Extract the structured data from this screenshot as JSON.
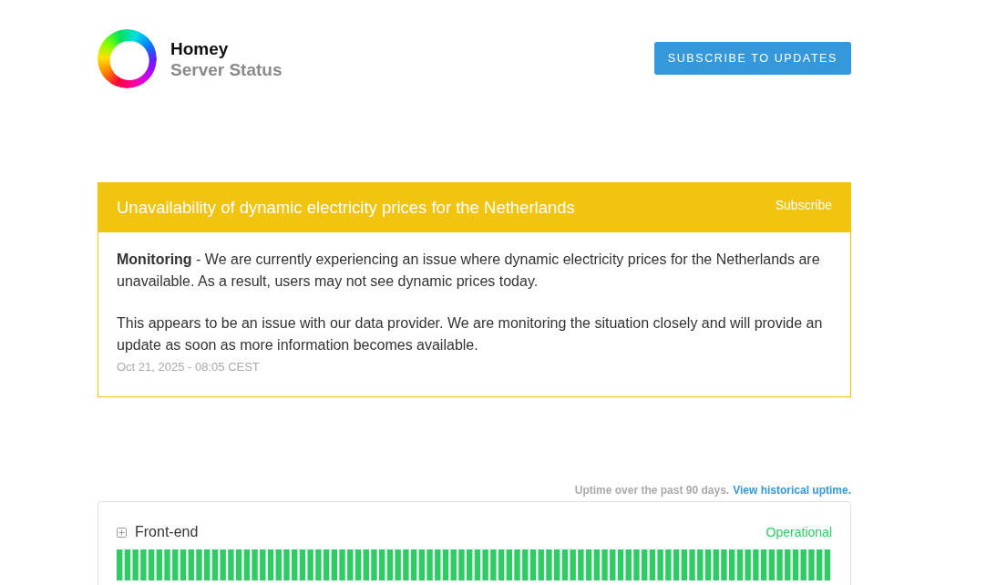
{
  "header": {
    "brand": "Homey",
    "subtitle": "Server Status",
    "subscribe_button": "SUBSCRIBE TO UPDATES"
  },
  "incident": {
    "title": "Unavailability of dynamic electricity prices for the Netherlands",
    "subscribe_link": "Subscribe",
    "kind": "monitoring",
    "updates": [
      {
        "paragraphs": [
          "**Monitoring** - We are currently experiencing an issue where dynamic electricity prices for the Netherlands are unavailable. As a result, users may not see dynamic prices today.",
          "This appears to be an issue with our data provider. We are monitoring the situation closely and will provide an update as soon as more information becomes available."
        ],
        "timestamp": "Oct 21, 2025 - 08:05 CEST"
      }
    ]
  },
  "uptime": {
    "caption": "Uptime over the past 90 days.",
    "link": "View historical uptime."
  },
  "components": [
    {
      "name": "Front-end",
      "status": "Operational",
      "kind": "operational",
      "expanded": false
    }
  ]
}
